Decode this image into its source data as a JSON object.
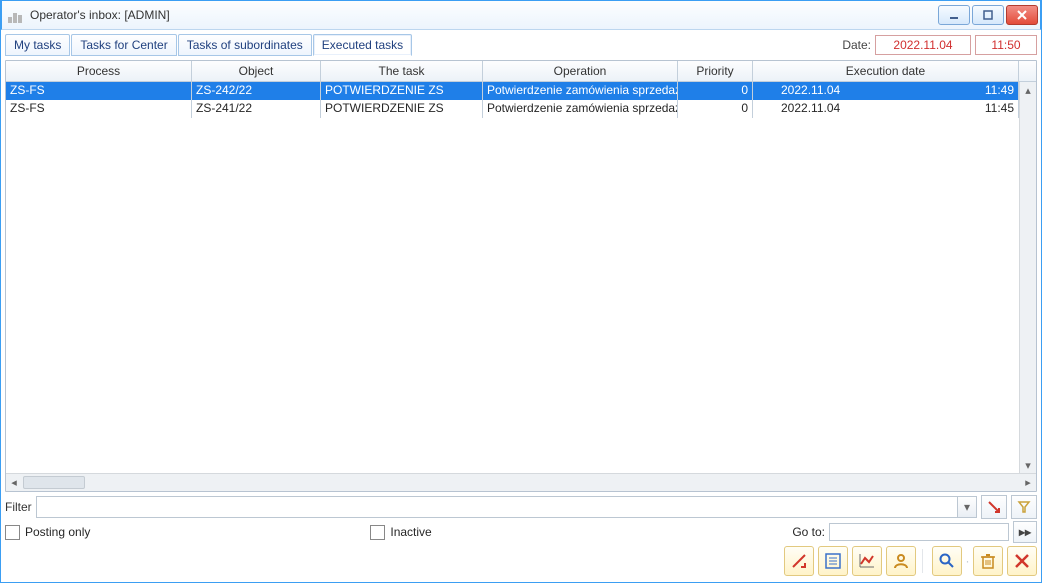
{
  "window": {
    "title": "Operator's inbox: [ADMIN]"
  },
  "tabs": {
    "t0": "My tasks",
    "t1": "Tasks for Center",
    "t2": "Tasks of subordinates",
    "t3": "Executed tasks"
  },
  "date": {
    "label": "Date:",
    "value": "2022.11.04",
    "time": "11:50"
  },
  "columns": {
    "c0": "Process",
    "c1": "Object",
    "c2": "The task",
    "c3": "Operation",
    "c4": "Priority",
    "c5": "Execution date"
  },
  "rows": [
    {
      "process": "ZS-FS",
      "object": "ZS-242/22",
      "task": "POTWIERDZENIE ZS",
      "operation": "Potwierdzenie zamówienia sprzedaży",
      "priority": "0",
      "exec_date": "2022.11.04",
      "exec_time": "11:49"
    },
    {
      "process": "ZS-FS",
      "object": "ZS-241/22",
      "task": "POTWIERDZENIE ZS",
      "operation": "Potwierdzenie zamówienia sprzedaży",
      "priority": "0",
      "exec_date": "2022.11.04",
      "exec_time": "11:45"
    }
  ],
  "filter": {
    "label": "Filter"
  },
  "checks": {
    "posting_only": "Posting only",
    "inactive": "Inactive"
  },
  "goto": {
    "label": "Go to:",
    "value": ""
  }
}
